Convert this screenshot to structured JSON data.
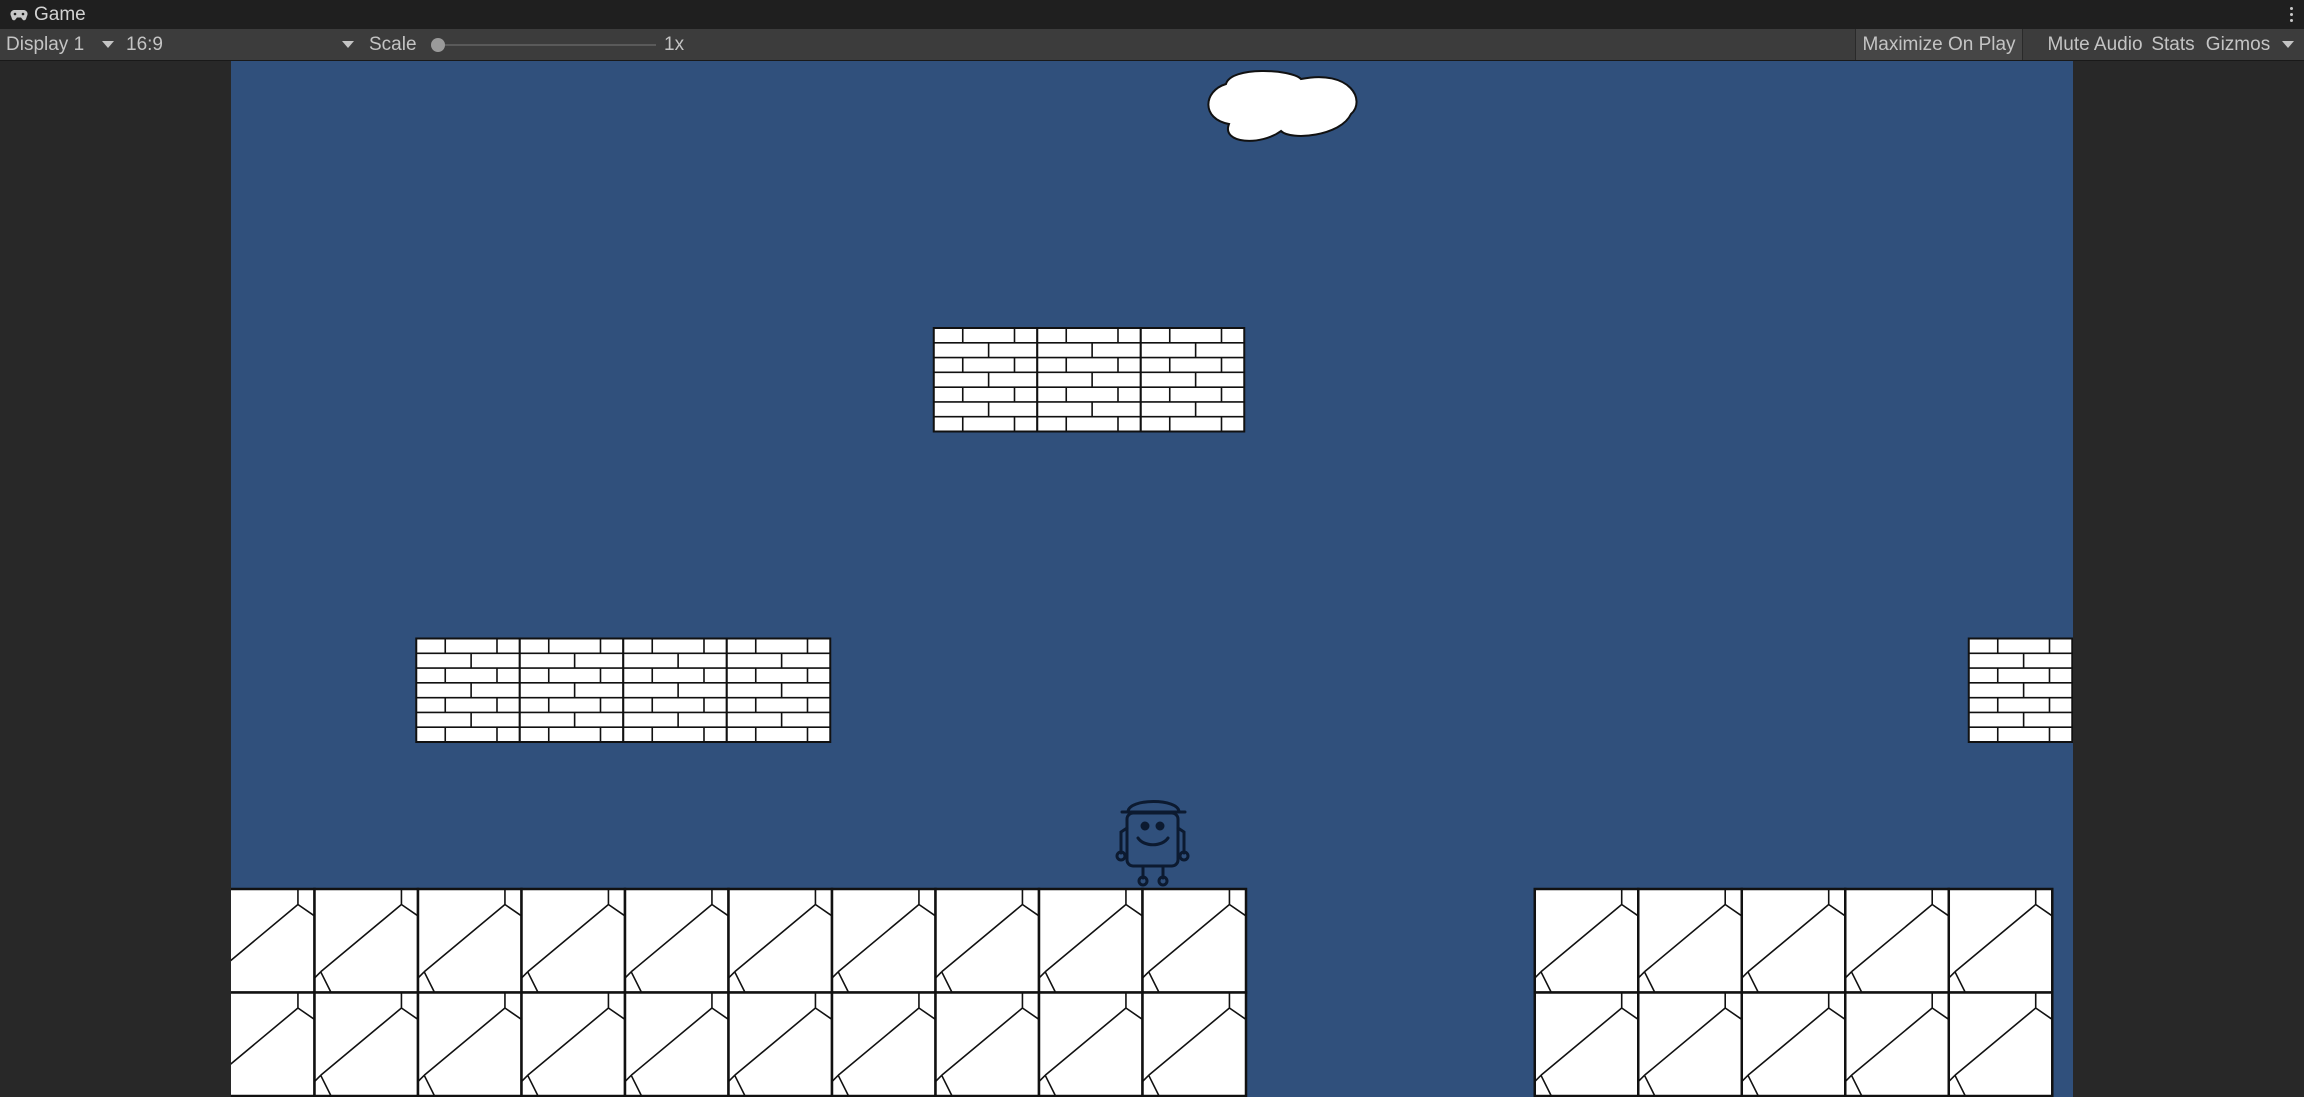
{
  "tab": {
    "title": "Game",
    "icon": "gamepad-icon"
  },
  "toolbar": {
    "display": "Display 1",
    "aspect": "16:9",
    "scale_label": "Scale",
    "scale_value": "1x",
    "maximize": "Maximize On Play",
    "mute": "Mute Audio",
    "stats": "Stats",
    "gizmos": "Gizmos"
  },
  "scene": {
    "sky_color": "#30507c",
    "tile_fill": "#ffffff",
    "outline_color": "#111111",
    "brick_platforms": [
      {
        "col": 6.79,
        "row": 2.0,
        "count": 3
      },
      {
        "col": 1.79,
        "row": 5.0,
        "count": 4
      },
      {
        "col": 16.79,
        "row": 5.0,
        "count": 1
      }
    ],
    "ground_segments": [
      {
        "col": 0,
        "count": 10
      },
      {
        "col": 12.79,
        "count": 5
      }
    ],
    "cloud": "cloud",
    "player": "player-character"
  }
}
